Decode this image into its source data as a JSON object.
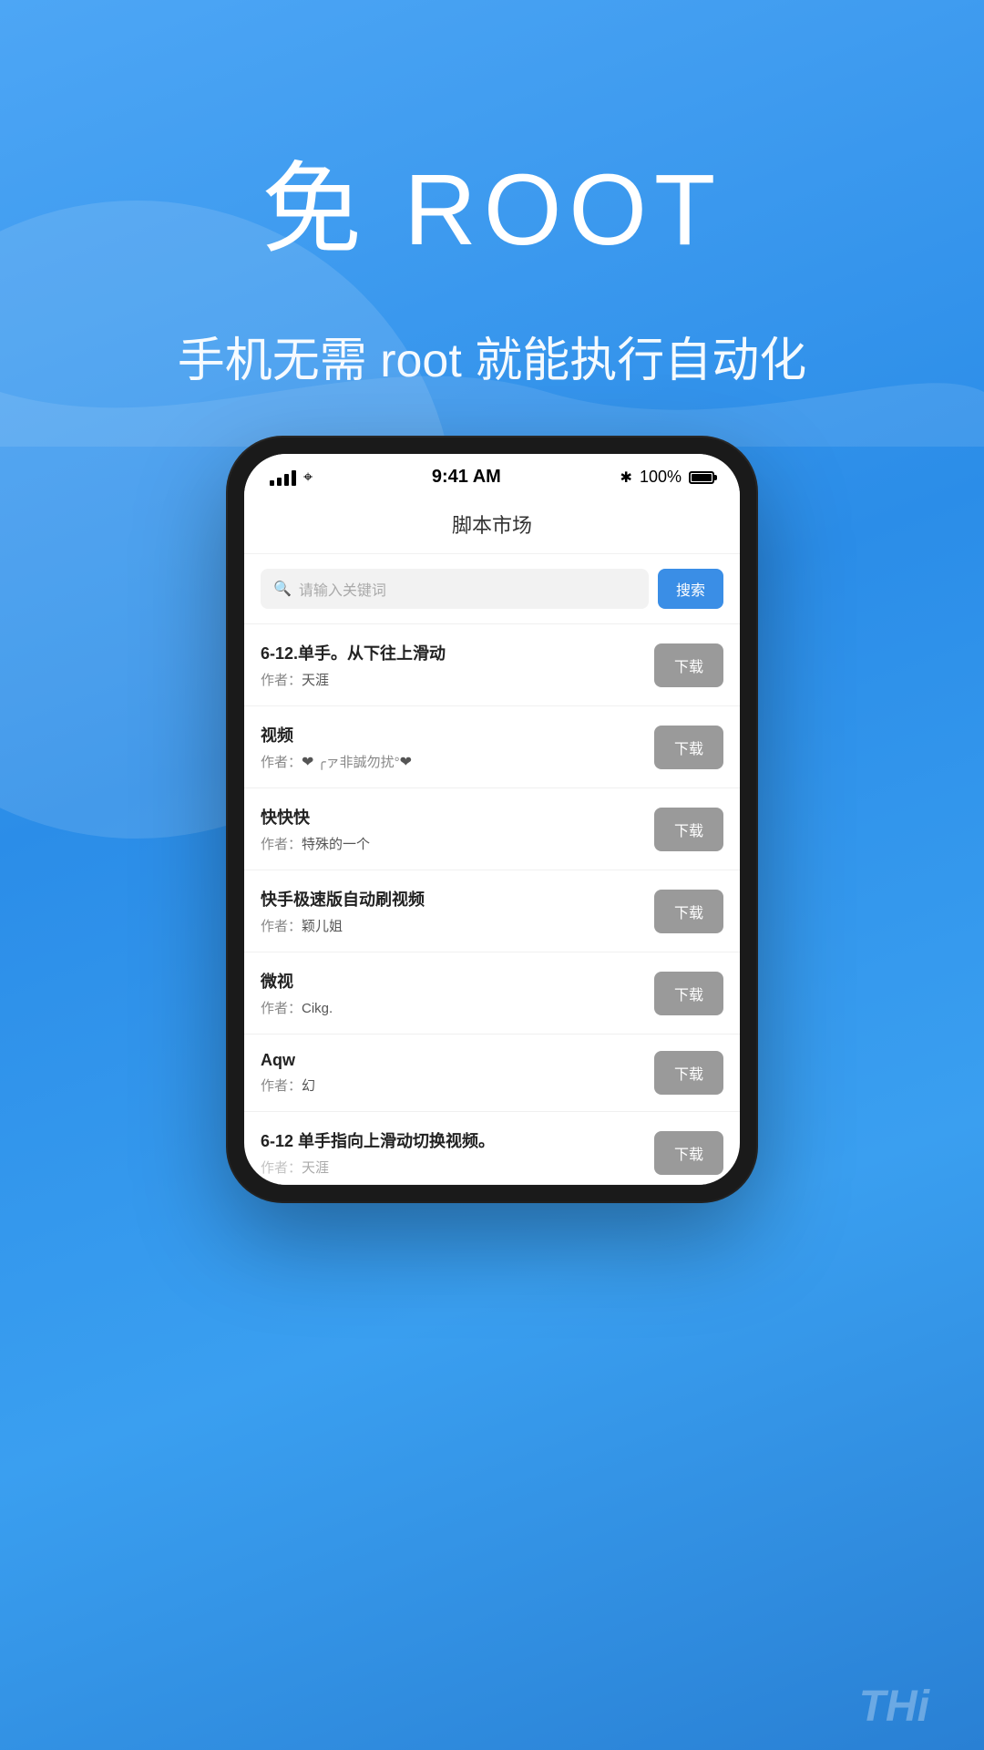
{
  "background": {
    "gradient_start": "#4da6f5",
    "gradient_end": "#2980d4"
  },
  "hero": {
    "title": "免 ROOT",
    "subtitle": "手机无需 root 就能执行自动化"
  },
  "phone": {
    "status_bar": {
      "time": "9:41 AM",
      "battery_percent": "100%",
      "bluetooth": "✱"
    },
    "header": {
      "title": "脚本市场"
    },
    "search": {
      "placeholder": "请输入关键词",
      "button_label": "搜索"
    },
    "scripts": [
      {
        "name": "6-12.单手。从下往上滑动",
        "author": "天涯",
        "download_label": "下载"
      },
      {
        "name": "视频",
        "author_prefix": "作者：",
        "author_html": "❤ ╭ァ非誠勿扰°❤",
        "download_label": "下载"
      },
      {
        "name": "快快快",
        "author": "特殊的一个",
        "download_label": "下载"
      },
      {
        "name": "快手极速版自动刷视频",
        "author": "颖儿姐",
        "download_label": "下载"
      },
      {
        "name": "微视",
        "author": "Cikg.",
        "download_label": "下载"
      },
      {
        "name": "Aqw",
        "author": "幻",
        "download_label": "下载"
      },
      {
        "name": "6-12 单手指向上滑动切换视频。",
        "author": "天涯",
        "download_label": "下载"
      }
    ]
  },
  "watermark": {
    "text": "THi"
  }
}
